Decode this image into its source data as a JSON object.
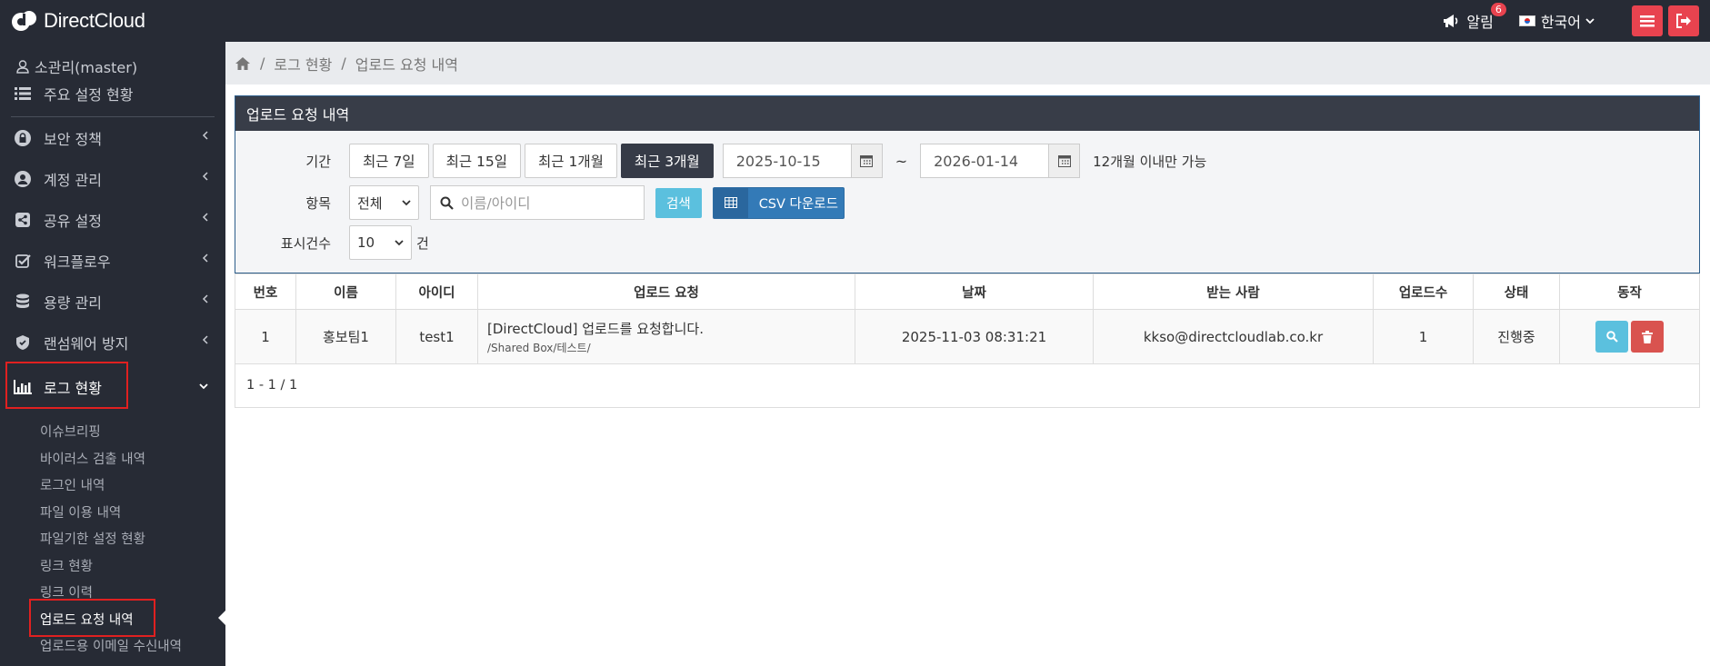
{
  "topbar": {
    "logo_text": "DirectCloud",
    "alarm_label": "알림",
    "alarm_count": "6",
    "language": "한국어",
    "accent_color": "#e8434f"
  },
  "sidebar": {
    "user": "소관리(master)",
    "items": [
      {
        "label": "주요 설정 현황",
        "icon": "list-icon"
      },
      {
        "label": "보안 정책",
        "icon": "lock-icon"
      },
      {
        "label": "계정 관리",
        "icon": "user-circle-icon"
      },
      {
        "label": "공유 설정",
        "icon": "share-icon"
      },
      {
        "label": "워크플로우",
        "icon": "check-square-icon"
      },
      {
        "label": "용량 관리",
        "icon": "database-icon"
      },
      {
        "label": "랜섬웨어 방지",
        "icon": "shield-icon"
      },
      {
        "label": "로그 현황",
        "icon": "bar-chart-icon"
      }
    ],
    "sub_items": [
      "이슈브리핑",
      "바이러스 검출 내역",
      "로그인 내역",
      "파일 이용 내역",
      "파일기한 설정 현황",
      "링크 현황",
      "링크 이력",
      "업로드 요청 내역",
      "업로드용 이메일 수신내역"
    ]
  },
  "breadcrumb": {
    "items": [
      "로그 현황",
      "업로드 요청 내역"
    ],
    "sep": "/"
  },
  "panel": {
    "title": "업로드 요청 내역",
    "period_label": "기간",
    "period_buttons": [
      "최근 7일",
      "최근 15일",
      "최근 1개월",
      "최근 3개월"
    ],
    "period_active": "최근 3개월",
    "date_from": "2025-10-15",
    "date_to": "2026-01-14",
    "tilde": "~",
    "period_note": "12개월 이내만 가능",
    "item_label": "항목",
    "item_select": "전체",
    "search_placeholder": "이름/아이디",
    "search_button": "검색",
    "csv_button": "CSV 다운로드",
    "count_label": "표시건수",
    "count_value": "10",
    "count_unit": "건"
  },
  "table": {
    "headers": [
      "번호",
      "이름",
      "아이디",
      "업로드 요청",
      "날짜",
      "받는 사람",
      "업로드수",
      "상태",
      "동작"
    ],
    "rows": [
      {
        "no": "1",
        "name": "홍보팀1",
        "id": "test1",
        "request": "[DirectCloud] 업로드를 요청합니다.",
        "path": "/Shared Box/테스트/",
        "date": "2025-11-03 08:31:21",
        "recipient": "kkso@directcloudlab.co.kr",
        "count": "1",
        "status": "진행중"
      }
    ],
    "pager": "1 - 1 / 1"
  }
}
